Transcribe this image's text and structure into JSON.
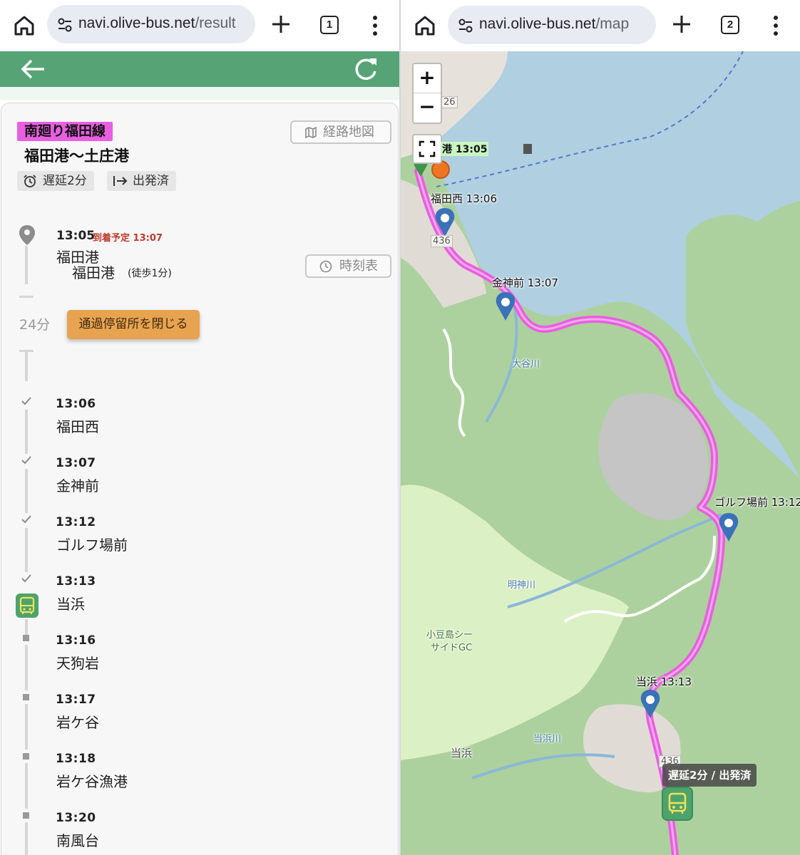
{
  "left_browser": {
    "url_domain": "navi.olive-bus.net",
    "url_path": "/result",
    "tab_count": "1"
  },
  "right_browser": {
    "url_domain": "navi.olive-bus.net",
    "url_path": "/map",
    "tab_count": "2"
  },
  "route": {
    "line_name": "南廻り福田線",
    "destination": "福田港〜土庄港",
    "delay": "遅延2分",
    "status": "出発済",
    "map_button": "経路地図",
    "badge_color": "#e85fe0",
    "header_color": "#56a475"
  },
  "origin": {
    "time": "13:05",
    "arrival_estimate": "到着予定 13:07",
    "name": "福田港",
    "platform": "福田港",
    "walk": "(徒歩1分)",
    "timetable_button": "時刻表"
  },
  "duration": "24分",
  "close_stops_button": "通過停留所を閉じる",
  "stops": [
    {
      "time": "13:06",
      "name": "福田西",
      "passed": true
    },
    {
      "time": "13:07",
      "name": "金神前",
      "passed": true
    },
    {
      "time": "13:12",
      "name": "ゴルフ場前",
      "passed": true
    },
    {
      "time": "13:13",
      "name": "当浜",
      "passed": true,
      "bus_here": true
    },
    {
      "time": "13:16",
      "name": "天狗岩",
      "passed": false
    },
    {
      "time": "13:17",
      "name": "岩ケ谷",
      "passed": false
    },
    {
      "time": "13:18",
      "name": "岩ケ谷漁港",
      "passed": false
    },
    {
      "time": "13:20",
      "name": "南風台",
      "passed": false
    }
  ],
  "map": {
    "origin_label": "港 13:05",
    "stop_labels": [
      "福田西 13:06",
      "金神前 13:07",
      "ゴルフ場前 13:12",
      "当浜 13:13"
    ],
    "status_tooltip": "遅延2分 / 出発済",
    "road_numbers": [
      "26",
      "436",
      "436"
    ],
    "place_names": [
      "小豆島シー",
      "サイドGC",
      "当浜",
      "当浜川",
      "明神川",
      "大谷川"
    ],
    "zoom_in": "+",
    "zoom_out": "−",
    "route_color": "#e85fe0",
    "sea_color": "#b0cfe0",
    "forest_color": "#add19e"
  }
}
